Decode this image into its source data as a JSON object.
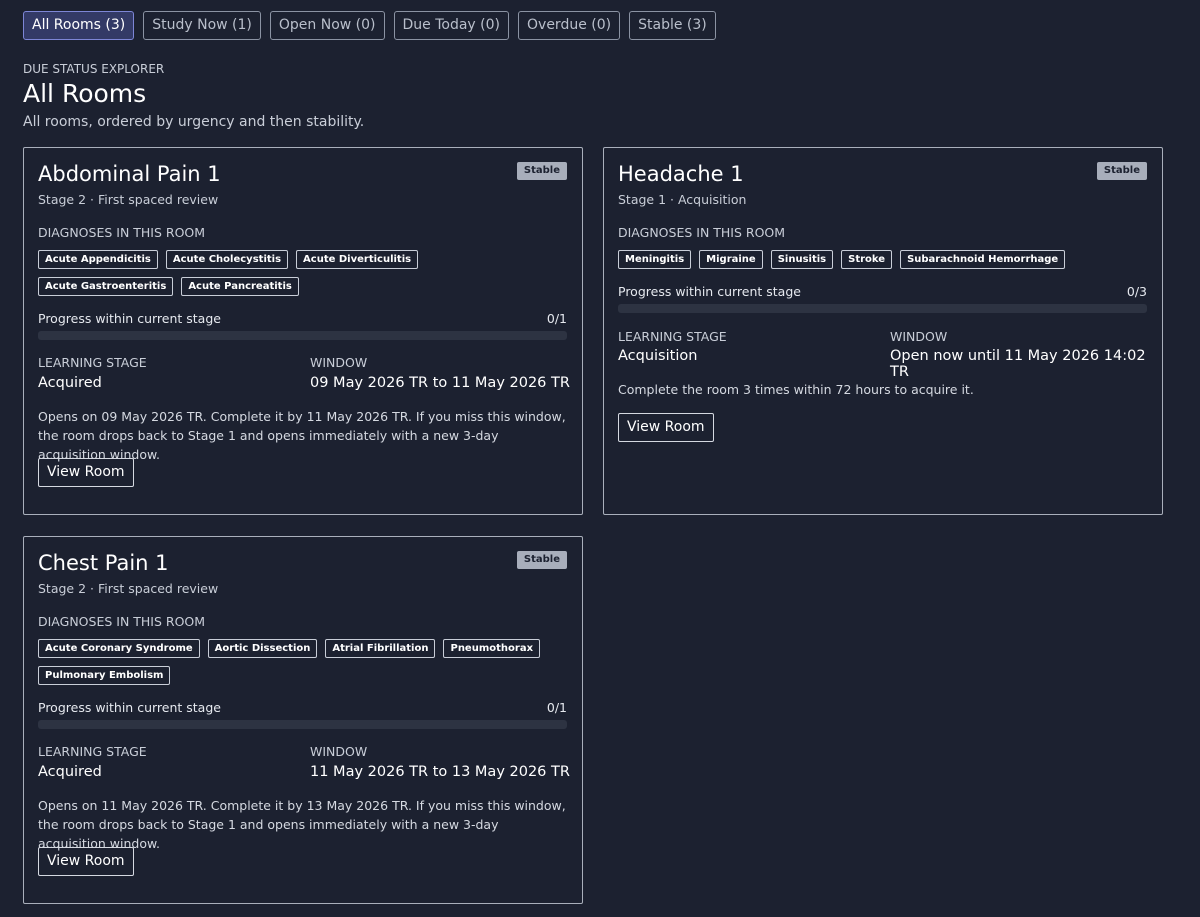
{
  "tabs": [
    {
      "label": "All Rooms (3)"
    },
    {
      "label": "Study Now (1)"
    },
    {
      "label": "Open Now (0)"
    },
    {
      "label": "Due Today (0)"
    },
    {
      "label": "Overdue (0)"
    },
    {
      "label": "Stable (3)"
    }
  ],
  "header": {
    "eyebrow": "DUE STATUS EXPLORER",
    "title": "All Rooms",
    "subtitle": "All rooms, ordered by urgency and then stability."
  },
  "common": {
    "diagnoses_label": "DIAGNOSES IN THIS ROOM",
    "progress_label": "Progress within current stage",
    "learning_stage_label": "LEARNING STAGE",
    "window_label": "WINDOW",
    "view_button": "View Room"
  },
  "colors": {
    "background": "#1c2130",
    "active_tab": "#333a66",
    "badge": "#a8aebb",
    "progress_track": "#2d3342"
  },
  "cards": [
    {
      "title": "Abdominal Pain 1",
      "badge": "Stable",
      "stage": "Stage 2 · First spaced review",
      "diagnoses": [
        "Acute Appendicitis",
        "Acute Cholecystitis",
        "Acute Diverticulitis",
        "Acute Gastroenteritis",
        "Acute Pancreatitis"
      ],
      "progress_text": "0/1",
      "progress_fraction": 0,
      "learning_stage": "Acquired",
      "window": "09 May 2026 TR to 11 May 2026 TR",
      "note": "Opens on 09 May 2026 TR. Complete it by 11 May 2026 TR. If you miss this window, the room drops back to Stage 1 and opens immediately with a new 3-day acquisition window."
    },
    {
      "title": "Headache 1",
      "badge": "Stable",
      "stage": "Stage 1 · Acquisition",
      "diagnoses": [
        "Meningitis",
        "Migraine",
        "Sinusitis",
        "Stroke",
        "Subarachnoid Hemorrhage"
      ],
      "progress_text": "0/3",
      "progress_fraction": 0,
      "learning_stage": "Acquisition",
      "window": "Open now until 11 May 2026 14:02 TR",
      "note": "Complete the room 3 times within 72 hours to acquire it."
    },
    {
      "title": "Chest Pain 1",
      "badge": "Stable",
      "stage": "Stage 2 · First spaced review",
      "diagnoses": [
        "Acute Coronary Syndrome",
        "Aortic Dissection",
        "Atrial Fibrillation",
        "Pneumothorax",
        "Pulmonary Embolism"
      ],
      "progress_text": "0/1",
      "progress_fraction": 0,
      "learning_stage": "Acquired",
      "window": "11 May 2026 TR to 13 May 2026 TR",
      "note": "Opens on 11 May 2026 TR. Complete it by 13 May 2026 TR. If you miss this window, the room drops back to Stage 1 and opens immediately with a new 3-day acquisition window."
    }
  ]
}
